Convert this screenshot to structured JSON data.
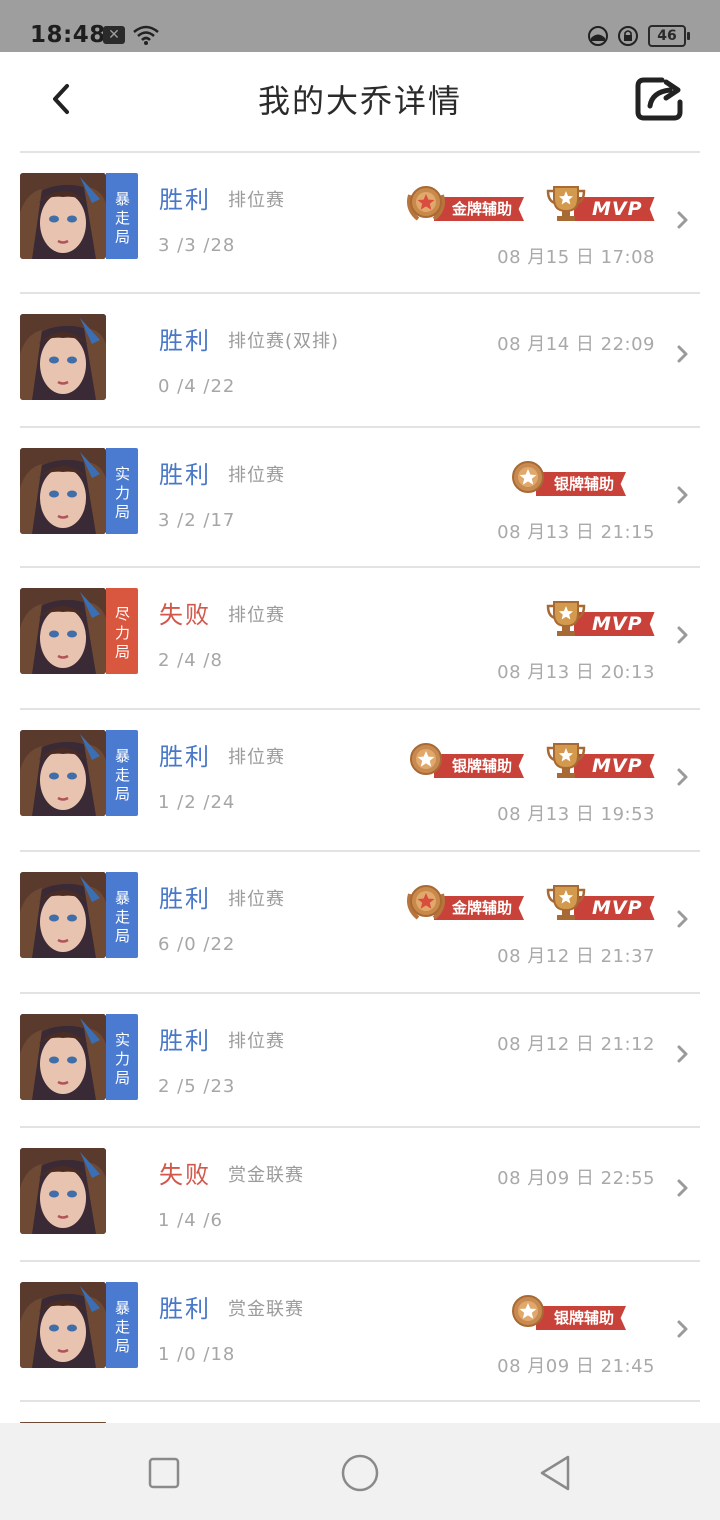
{
  "status_bar": {
    "time": "18:48",
    "battery": "46"
  },
  "header": {
    "title": "我的大乔详情"
  },
  "colors": {
    "win": "#4a78c8",
    "lose": "#d2574a",
    "tag_blue": "#4a7bd0",
    "tag_red": "#d9573e",
    "ribbon": "#c8423a"
  },
  "matches": [
    {
      "tag": "暴走局",
      "tag_color": "blue",
      "result": "胜利",
      "result_type": "win",
      "mode": "排位赛",
      "kda": "3 /3 /28",
      "date": "08 月15 日  17:08",
      "badges": [
        "金牌辅助",
        "MVP"
      ]
    },
    {
      "tag": "",
      "tag_color": "",
      "result": "胜利",
      "result_type": "win",
      "mode": "排位赛(双排)",
      "kda": "0 /4 /22",
      "date": "08 月14 日  22:09",
      "badges": []
    },
    {
      "tag": "实力局",
      "tag_color": "blue",
      "result": "胜利",
      "result_type": "win",
      "mode": "排位赛",
      "kda": "3 /2 /17",
      "date": "08 月13 日  21:15",
      "badges": [
        "银牌辅助"
      ]
    },
    {
      "tag": "尽力局",
      "tag_color": "red",
      "result": "失败",
      "result_type": "lose",
      "mode": "排位赛",
      "kda": "2 /4 /8",
      "date": "08 月13 日  20:13",
      "badges": [
        "MVP"
      ]
    },
    {
      "tag": "暴走局",
      "tag_color": "blue",
      "result": "胜利",
      "result_type": "win",
      "mode": "排位赛",
      "kda": "1 /2 /24",
      "date": "08 月13 日  19:53",
      "badges": [
        "银牌辅助",
        "MVP"
      ]
    },
    {
      "tag": "暴走局",
      "tag_color": "blue",
      "result": "胜利",
      "result_type": "win",
      "mode": "排位赛",
      "kda": "6 /0 /22",
      "date": "08 月12 日  21:37",
      "badges": [
        "金牌辅助",
        "MVP"
      ]
    },
    {
      "tag": "实力局",
      "tag_color": "blue",
      "result": "胜利",
      "result_type": "win",
      "mode": "排位赛",
      "kda": "2 /5 /23",
      "date": "08 月12 日  21:12",
      "badges": []
    },
    {
      "tag": "",
      "tag_color": "",
      "result": "失败",
      "result_type": "lose",
      "mode": "赏金联赛",
      "kda": "1 /4 /6",
      "date": "08 月09 日  22:55",
      "badges": []
    },
    {
      "tag": "暴走局",
      "tag_color": "blue",
      "result": "胜利",
      "result_type": "win",
      "mode": "赏金联赛",
      "kda": "1 /0 /18",
      "date": "08 月09 日  21:45",
      "badges": [
        "银牌辅助"
      ]
    }
  ]
}
